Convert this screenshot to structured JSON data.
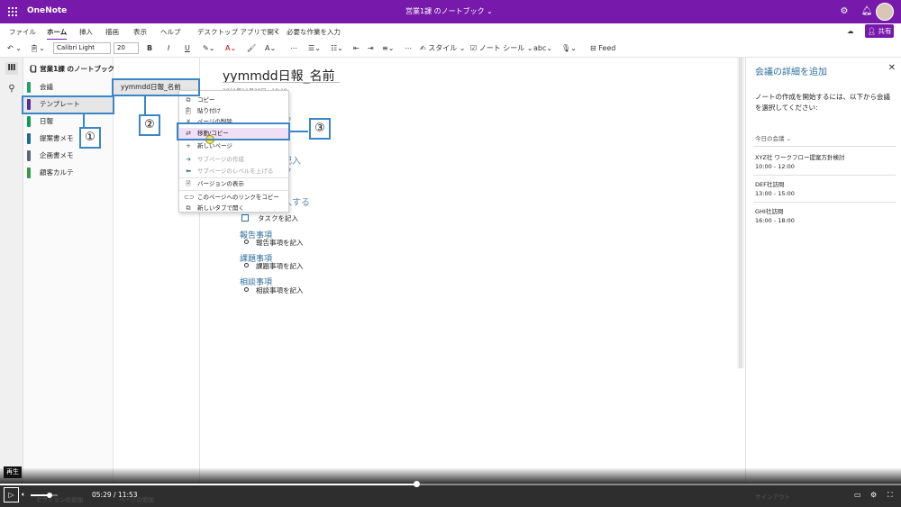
{
  "app": {
    "name": "OneNote",
    "notebook_title": "営業1課 のノートブック",
    "share_label": "共有"
  },
  "menu_tabs": [
    "ファイル",
    "ホーム",
    "挿入",
    "描画",
    "表示",
    "ヘルプ",
    "デスクトップ アプリで開く"
  ],
  "search_hint": "必要な作業を入力",
  "ribbon": {
    "font_name": "Calibri Light",
    "font_size": "20",
    "bold": "B",
    "italic": "I",
    "underline": "U",
    "styles_label": "スタイル",
    "note_tags_label": "ノート シール",
    "feed_label": "Feed"
  },
  "sections_pane": {
    "notebook_label": "営業1課 のノートブック",
    "sections": [
      {
        "label": "会議",
        "color": "#21a366"
      },
      {
        "label": "テンプレート",
        "color": "#5c2d91"
      },
      {
        "label": "日報",
        "color": "#0f9d58"
      },
      {
        "label": "提案書メモ",
        "color": "#1e6b8e"
      },
      {
        "label": "企画書メモ",
        "color": "#5d6a74"
      },
      {
        "label": "顧客カルテ",
        "color": "#2f9e44"
      }
    ]
  },
  "pages_pane": {
    "pages": [
      "yymmdd日報_名前"
    ]
  },
  "page": {
    "title": "yymmdd日報_名前",
    "date_text": "2021年11月28日　18:18",
    "partial_headings": [
      "る",
      "記入",
      "ク",
      "入する"
    ],
    "task_item": "タスクを記入",
    "report_heading": "報告事項",
    "report_item": "報告事項を記入",
    "issue_heading": "課題事項",
    "issue_item": "課題事項を記入",
    "consult_heading": "相談事項",
    "consult_item": "相談事項を記入"
  },
  "context_menu": {
    "items": [
      {
        "label": "コピー",
        "icon": "copy-icon",
        "disabled": false
      },
      {
        "label": "貼り付け",
        "icon": "paste-icon",
        "disabled": false
      },
      {
        "label": "ページの削除",
        "icon": "delete-icon",
        "disabled": false
      },
      {
        "label": "移動/コピー",
        "icon": "move-copy-icon",
        "disabled": false,
        "highlighted": true
      },
      {
        "label": "新しいページ",
        "icon": "plus-icon",
        "disabled": false
      },
      {
        "label": "サブページの作成",
        "icon": "arrow-right-icon",
        "disabled": true
      },
      {
        "label": "サブページのレベルを上げる",
        "icon": "arrow-left-icon",
        "disabled": true
      },
      {
        "label": "バージョンの表示",
        "icon": "versions-icon",
        "disabled": false
      },
      {
        "label": "このページへのリンクをコピー",
        "icon": "link-icon",
        "disabled": false
      },
      {
        "label": "新しいタブで開く",
        "icon": "open-tab-icon",
        "disabled": false
      }
    ]
  },
  "callouts": [
    "①",
    "②",
    "③"
  ],
  "meeting_pane": {
    "title": "会議の詳細を追加",
    "description": "ノートの作成を開始するには、以下から会議を選択してください:",
    "today_label": "今日の会議",
    "meetings": [
      {
        "name": "XYZ社 ワークフロー提案方針検討",
        "time": "10:00 - 12:00"
      },
      {
        "name": "DEF社訪問",
        "time": "13:00 - 15:00"
      },
      {
        "name": "GHI社訪問",
        "time": "16:00 - 18:00"
      }
    ],
    "sign_out": "サインアウト"
  },
  "video": {
    "tooltip": "再生",
    "current_time": "05:29",
    "separator": "/",
    "duration": "11:53",
    "progress_fraction": 0.4617,
    "volume_fraction": 0.7,
    "bottom_left_text_1": "セクションの追加",
    "bottom_left_text_2": "ページの追加"
  },
  "colors": {
    "brand": "#7719aa",
    "callout": "#3a86c8",
    "heading": "#2e6f9e"
  }
}
